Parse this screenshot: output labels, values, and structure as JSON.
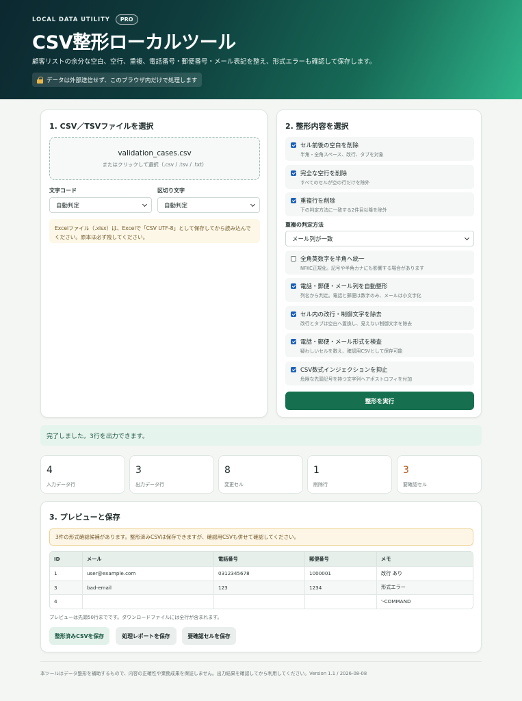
{
  "hero": {
    "eyebrow": "LOCAL DATA UTILITY",
    "badge": "PRO",
    "title": "CSV整形ローカルツール",
    "description": "顧客リストの余分な空白、空行、重複、電話番号・郵便番号・メール表記を整え、形式エラーも確認して保存します。",
    "privacy_notice": "データは外部送信せず、このブラウザ内だけで処理します"
  },
  "file_panel": {
    "title": "1. CSV／TSVファイルを選択",
    "file_name": "validation_cases.csv",
    "drop_hint": "またはクリックして選択（.csv / .tsv / .txt）",
    "encoding_label": "文字コード",
    "encoding_value": "自動判定",
    "delimiter_label": "区切り文字",
    "delimiter_value": "自動判定",
    "excel_note": "Excelファイル（.xlsx）は、Excelで「CSV UTF-8」として保存してから読み込んでください。原本は必ず残してください。"
  },
  "options_panel": {
    "title": "2. 整形内容を選択",
    "options_top": [
      {
        "title": "セル前後の空白を削除",
        "sub": "半角・全角スペース、改行、タブを対象",
        "checked": true
      },
      {
        "title": "完全な空行を削除",
        "sub": "すべてのセルが空の行だけを除外",
        "checked": true
      },
      {
        "title": "重複行を削除",
        "sub": "下の判定方法に一致する2件目以降を除外",
        "checked": true
      }
    ],
    "dup_label": "重複の判定方法",
    "dup_value": "メール列が一致",
    "options_bottom": [
      {
        "title": "全角英数字を半角へ統一",
        "sub": "NFKC正規化。記号や半角カナにも影響する場合があります",
        "checked": false
      },
      {
        "title": "電話・郵便・メール列を自動整形",
        "sub": "列名から判定。電話と郵便は数字のみ、メールは小文字化",
        "checked": true
      },
      {
        "title": "セル内の改行・制御文字を除去",
        "sub": "改行とタブは空白へ置換し、見えない制御文字を除去",
        "checked": true
      },
      {
        "title": "電話・郵便・メール形式を検査",
        "sub": "疑わしいセルを数え、確認用CSVとして保存可能",
        "checked": true
      },
      {
        "title": "CSV数式インジェクションを抑止",
        "sub": "危険な先頭記号を持つ文字列へアポストロフィを付加",
        "checked": true
      }
    ],
    "run_button": "整形を実行"
  },
  "status_message": "完了しました。3行を出力できます。",
  "stats": [
    {
      "value": "4",
      "label": "入力データ行",
      "warn": false
    },
    {
      "value": "3",
      "label": "出力データ行",
      "warn": false
    },
    {
      "value": "8",
      "label": "変更セル",
      "warn": false
    },
    {
      "value": "1",
      "label": "削除行",
      "warn": false
    },
    {
      "value": "3",
      "label": "要確認セル",
      "warn": true
    }
  ],
  "preview": {
    "title": "3. プレビューと保存",
    "alert": "3件の形式確認候補があります。整形済みCSVは保存できますが、確認用CSVも併せて確認してください。",
    "columns": [
      "ID",
      "メール",
      "電話番号",
      "郵便番号",
      "メモ"
    ],
    "rows": [
      [
        "1",
        "user@example.com",
        "0312345678",
        "1000001",
        "改行 あり"
      ],
      [
        "3",
        "bad-email",
        "123",
        "1234",
        "形式エラー"
      ],
      [
        "4",
        "",
        "",
        "",
        "'-COMMAND"
      ]
    ],
    "note": "プレビューは先頭50行までです。ダウンロードファイルには全行が含まれます。",
    "buttons": [
      "整形済みCSVを保存",
      "処理レポートを保存",
      "要確認セルを保存"
    ]
  },
  "footer": "本ツールはデータ整形を補助するもので、内容の正確性や業務成果を保証しません。出力結果を確認してから利用してください。Version 1.1 / 2026-08-08"
}
